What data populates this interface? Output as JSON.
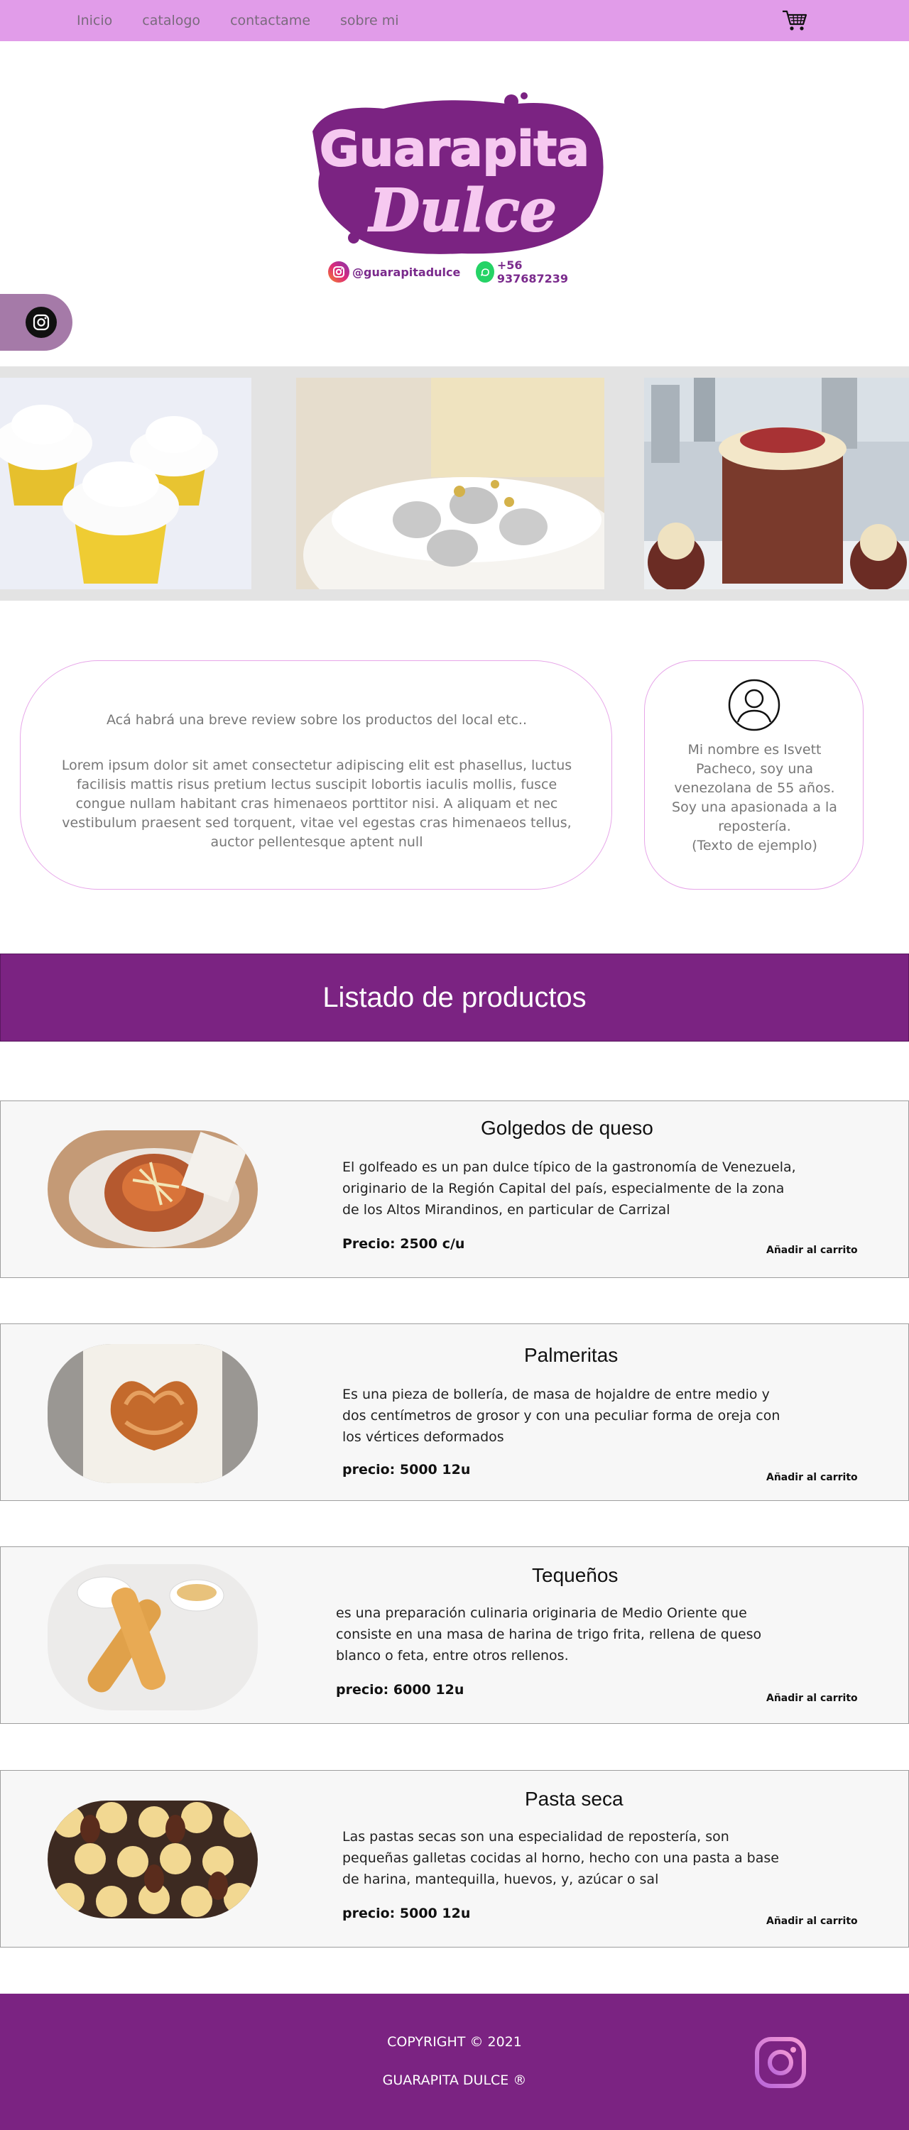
{
  "nav": {
    "links": [
      "Inicio",
      "catalogo",
      "contactame",
      "sobre mi"
    ],
    "cart_icon": "cart-icon"
  },
  "brand": {
    "logo_line1": "Guarapita",
    "logo_line2": "Dulce",
    "instagram_handle": "@guarapitadulce",
    "whatsapp_number": "+56 937687239",
    "colors": {
      "purple": "#7b2382",
      "pink_light": "#e19ce9",
      "logo_pink": "#f4c6ee"
    }
  },
  "review": {
    "title": "Acá habrá una breve review sobre los productos del local etc..",
    "body": "Lorem ipsum dolor sit amet consectetur adipiscing elit est phasellus, luctus facilisis mattis risus pretium lectus suscipit lobortis iaculis mollis, fusce congue nullam habitant cras himenaeos porttitor nisi. A aliquam et nec vestibulum praesent sed torquent, vitae vel egestas cras himenaeos tellus, auctor pellentesque aptent null"
  },
  "profile": {
    "text": "Mi nombre es Isvett Pacheco, soy una venezolana de 55 años. Soy una apasionada a la repostería.",
    "note": "(Texto de ejemplo)"
  },
  "products_header": "Listado de productos",
  "products": [
    {
      "name": "Golgedos de queso",
      "desc": "El golfeado es un pan dulce típico de la gastronomía de Venezuela, originario de la Región Capital del país, especialmente de la zona de los Altos Mirandinos, en particular de Carrizal",
      "price": "Precio: 2500 c/u",
      "button": "Añadir al carrito"
    },
    {
      "name": "Palmeritas",
      "desc": "Es una pieza de bollería, de masa de hojaldre de entre medio y dos centímetros de grosor y con una peculiar forma de oreja con los vértices deformados",
      "price": "precio: 5000 12u",
      "button": "Añadir al carrito"
    },
    {
      "name": "Tequeños",
      "desc": "es una preparación culinaria originaria de Medio Oriente que consiste en una masa de harina de trigo frita, rellena de queso blanco o feta, entre otros rellenos.",
      "price": "precio: 6000 12u",
      "button": "Añadir al carrito"
    },
    {
      "name": "Pasta seca",
      "desc": "Las pastas secas son una especialidad de repostería, son pequeñas galletas cocidas al horno, hecho con una pasta a base de harina, mantequilla, huevos, y, azúcar o sal",
      "price": "precio: 5000 12u",
      "button": "Añadir al carrito"
    }
  ],
  "footer": {
    "copyright": "COPYRIGHT © 2021",
    "brand": "GUARAPITA DULCE ®"
  }
}
